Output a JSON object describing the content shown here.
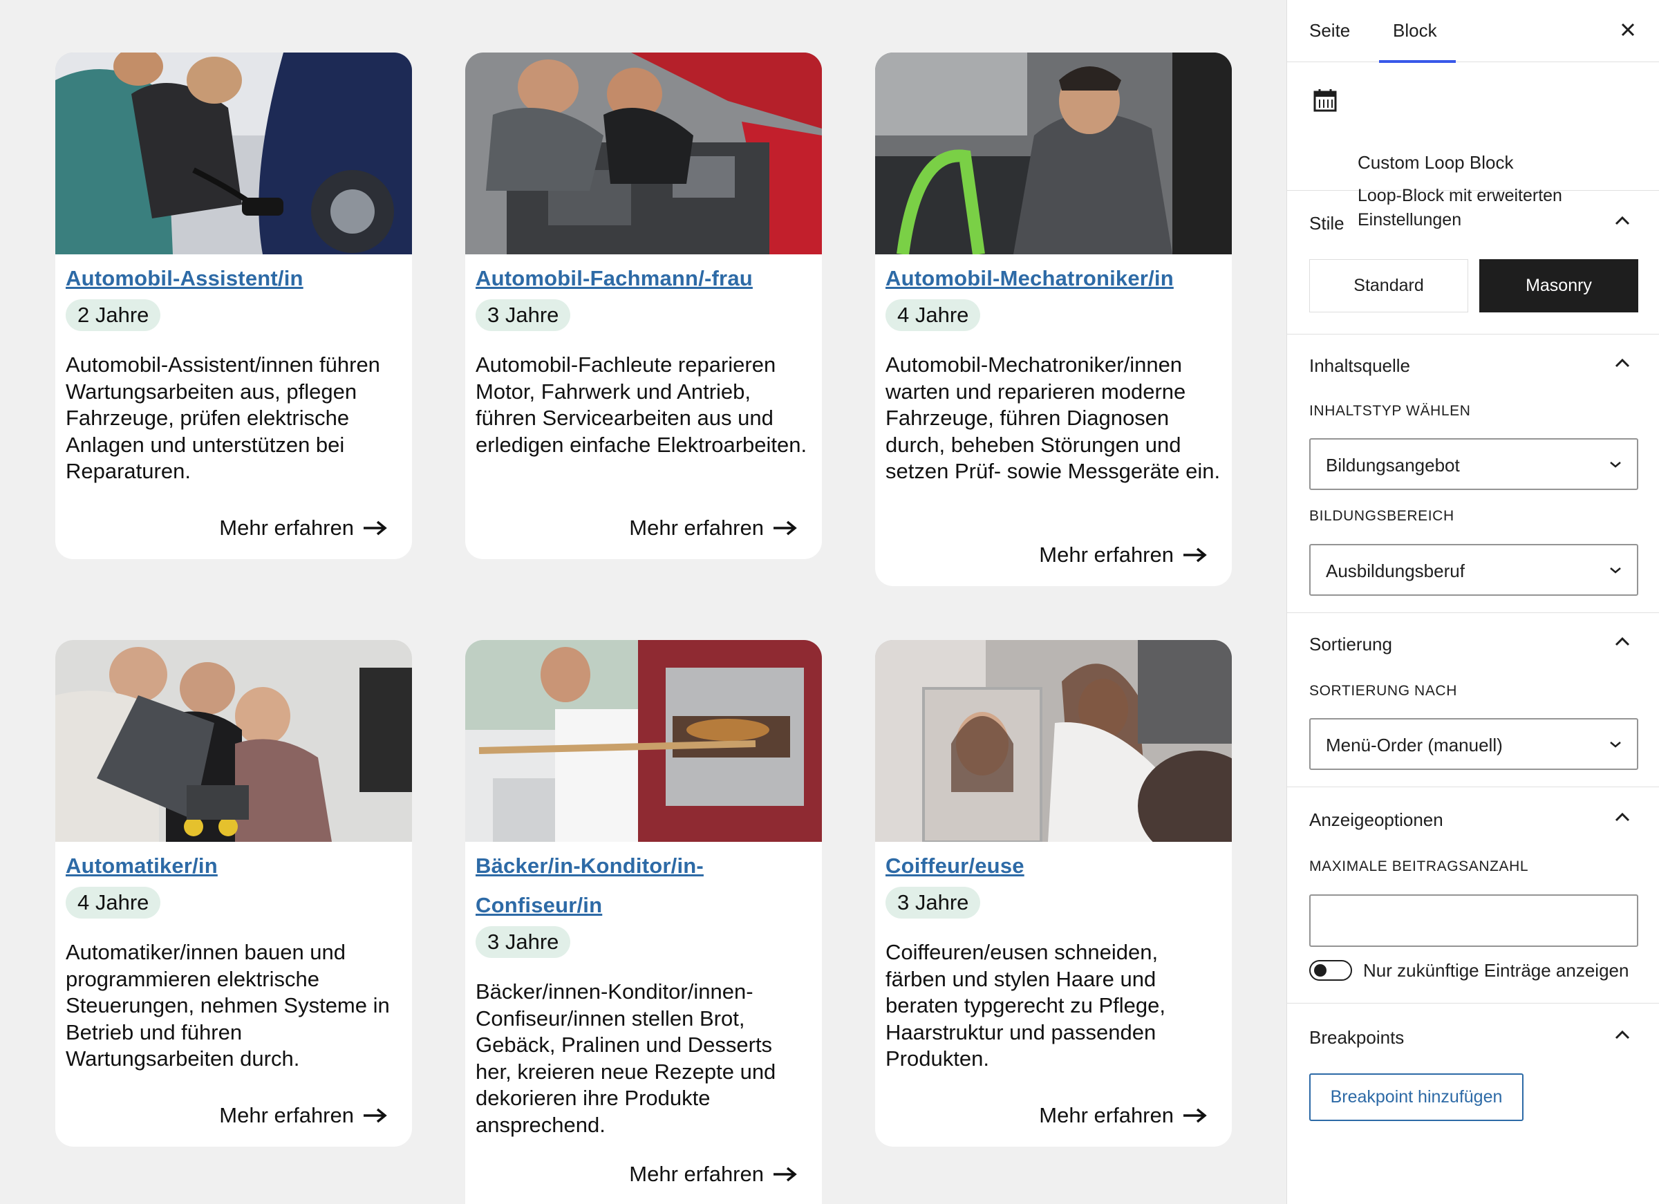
{
  "cards": [
    {
      "title": "Automobil-Assistent/in",
      "badge": "2 Jahre",
      "description": "Automobil-Assistent/innen führen Wartungsarbeiten aus, pflegen Fahrzeuge, prüfen elektrische Anlagen und unterstützen bei Reparaturen.",
      "more": "Mehr erfahren"
    },
    {
      "title": "Automobil-Fachmann/-frau",
      "badge": "3 Jahre",
      "description": "Automobil-Fachleute reparieren Motor, Fahrwerk und Antrieb, führen Servicearbeiten aus und erledigen einfache Elektroarbeiten.",
      "more": "Mehr erfahren"
    },
    {
      "title": "Automobil-Mechatroniker/in",
      "badge": "4 Jahre",
      "description": "Automobil-Mechatroniker/innen warten und reparieren moderne Fahrzeuge, führen Diagnosen durch, beheben Störungen und setzen Prüf- sowie Messgeräte ein.",
      "more": "Mehr erfahren"
    },
    {
      "title": "Automatiker/in",
      "badge": "4 Jahre",
      "description": "Automatiker/innen bauen und programmieren elektrische Steuerungen, nehmen Systeme in Betrieb und führen Wartungsarbeiten durch.",
      "more": "Mehr erfahren"
    },
    {
      "title": "Bäcker/in-Konditor/in-Confiseur/in",
      "badge": "3 Jahre",
      "description": "Bäcker/innen-Konditor/innen-Confiseur/innen stellen Brot, Gebäck, Pralinen und Desserts her, kreieren neue Rezepte und dekorieren ihre Produkte ansprechend.",
      "more": "Mehr erfahren"
    },
    {
      "title": "Coiffeur/euse",
      "badge": "3 Jahre",
      "description": "Coiffeuren/eusen schneiden, färben und stylen Haare und beraten typgerecht zu Pflege, Haarstruktur und passenden Produkten.",
      "more": "Mehr erfahren"
    }
  ],
  "sidebar": {
    "tabs": {
      "page": "Seite",
      "block": "Block"
    },
    "block": {
      "title": "Custom Loop Block",
      "subtitle": "Loop-Block mit erweiterten Einstellungen"
    },
    "styles": {
      "title": "Stile",
      "standard": "Standard",
      "masonry": "Masonry",
      "selected": "Masonry"
    },
    "source": {
      "title": "Inhaltsquelle",
      "type_label": "INHALTSTYP WÄHLEN",
      "type_value": "Bildungsangebot",
      "area_label": "BILDUNGSBEREICH",
      "area_value": "Ausbildungsberuf"
    },
    "sorting": {
      "title": "Sortierung",
      "label": "SORTIERUNG NACH",
      "value": "Menü-Order (manuell)"
    },
    "display": {
      "title": "Anzeigeoptionen",
      "max_label": "MAXIMALE BEITRAGSANZAHL",
      "max_value": "",
      "toggle_label": "Nur zukünftige Einträge anzeigen",
      "toggle_on": false
    },
    "breakpoints": {
      "title": "Breakpoints",
      "add_button": "Breakpoint hinzufügen"
    }
  },
  "colors": {
    "link": "#2d6aa6",
    "badge_bg": "#e1efe8",
    "canvas_bg": "#f0f0f0",
    "accent": "#3858e9",
    "dark": "#1e1e1e"
  }
}
